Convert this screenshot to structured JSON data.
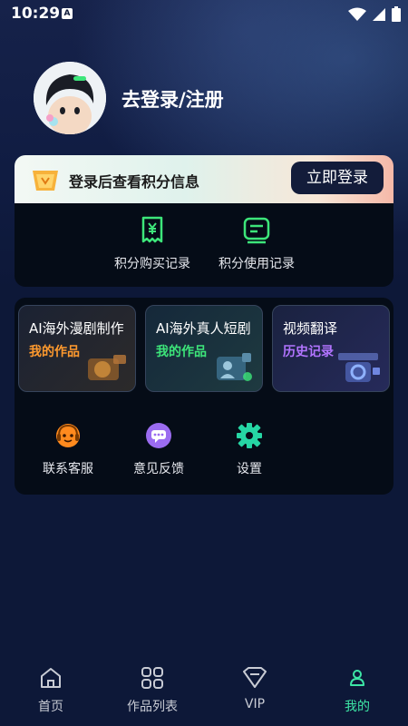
{
  "status": {
    "time": "10:29",
    "notification_glyph": "A"
  },
  "profile": {
    "login_title": "去登录/注册"
  },
  "points_banner": {
    "text": "登录后查看积分信息",
    "login_button": "立即登录"
  },
  "points_actions": [
    {
      "label": "积分购买记录",
      "icon": "yen-receipt-icon"
    },
    {
      "label": "积分使用记录",
      "icon": "list-card-icon"
    }
  ],
  "tiles": [
    {
      "title": "AI海外漫剧制作",
      "subtitle": "我的作品",
      "accent": "#ff9a2e"
    },
    {
      "title": "AI海外真人短剧",
      "subtitle": "我的作品",
      "accent": "#3de67a"
    },
    {
      "title": "视频翻译",
      "subtitle": "历史记录",
      "accent": "#b274ff"
    }
  ],
  "services": [
    {
      "label": "联系客服",
      "icon": "headset-icon"
    },
    {
      "label": "意见反馈",
      "icon": "chat-bubble-icon"
    },
    {
      "label": "设置",
      "icon": "gear-icon"
    }
  ],
  "tabs": [
    {
      "label": "首页",
      "icon": "home-icon"
    },
    {
      "label": "作品列表",
      "icon": "grid-icon"
    },
    {
      "label": "VIP",
      "icon": "diamond-icon"
    },
    {
      "label": "我的",
      "icon": "person-icon",
      "active": true
    }
  ],
  "colors": {
    "accent_green": "#3de6a6",
    "background": "#0d1838",
    "card": "#050c17"
  }
}
